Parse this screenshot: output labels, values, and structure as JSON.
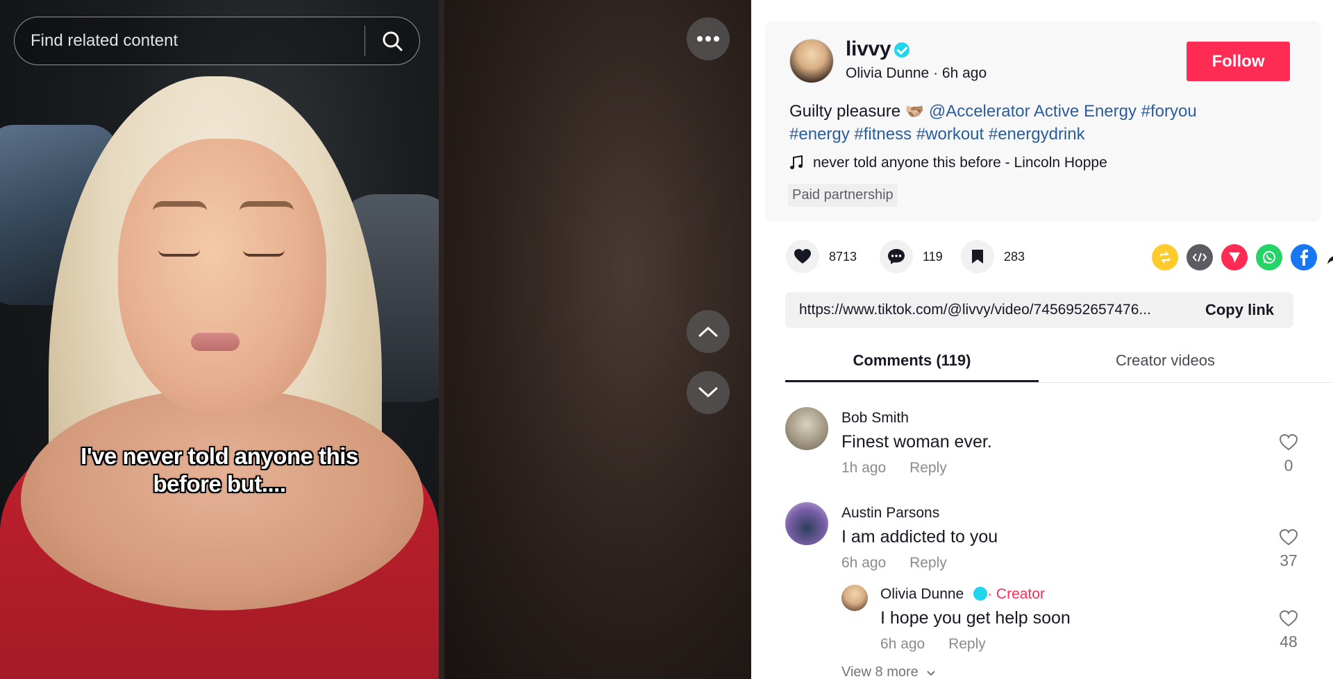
{
  "search": {
    "placeholder": "Find related content"
  },
  "video": {
    "caption_line1": "I've never told anyone this",
    "caption_line2": "before but...."
  },
  "post": {
    "username": "livvy",
    "display_name": "Olivia Dunne",
    "separator": " · ",
    "time_ago": "6h ago",
    "follow_label": "Follow",
    "description": {
      "text": "Guilty pleasure",
      "emoji": "🫱🏼‍🫲🏽",
      "mention": "@Accelerator Active Energy",
      "hashtags": [
        "#foryou",
        "#energy",
        "#fitness",
        "#workout",
        "#energydrink"
      ]
    },
    "music": "never told anyone this before - Lincoln Hoppe",
    "paid_label": "Paid partnership"
  },
  "actions": {
    "likes": "8713",
    "comments": "119",
    "saves": "283"
  },
  "share_icons": {
    "repost_color": "#fdcb2c",
    "embed_color": "#5c5c62",
    "send_color": "#fe2c55",
    "whatsapp_color": "#25d366",
    "facebook_color": "#1877f2"
  },
  "link": {
    "url": "https://www.tiktok.com/@livvy/video/7456952657476...",
    "copy_label": "Copy link"
  },
  "tabs": {
    "comments_label": "Comments (119)",
    "creator_label": "Creator videos"
  },
  "comments": [
    {
      "author": "Bob Smith",
      "text": "Finest woman ever.",
      "time": "1h ago",
      "reply": "Reply",
      "likes": "0"
    },
    {
      "author": "Austin Parsons",
      "text": "I am addicted to you",
      "time": "6h ago",
      "reply": "Reply",
      "likes": "37",
      "replies": [
        {
          "author": "Olivia Dunne",
          "badge": "· Creator",
          "text": "I hope you get help soon",
          "time": "6h ago",
          "reply": "Reply",
          "likes": "48"
        }
      ],
      "view_more": "View 8 more"
    }
  ]
}
